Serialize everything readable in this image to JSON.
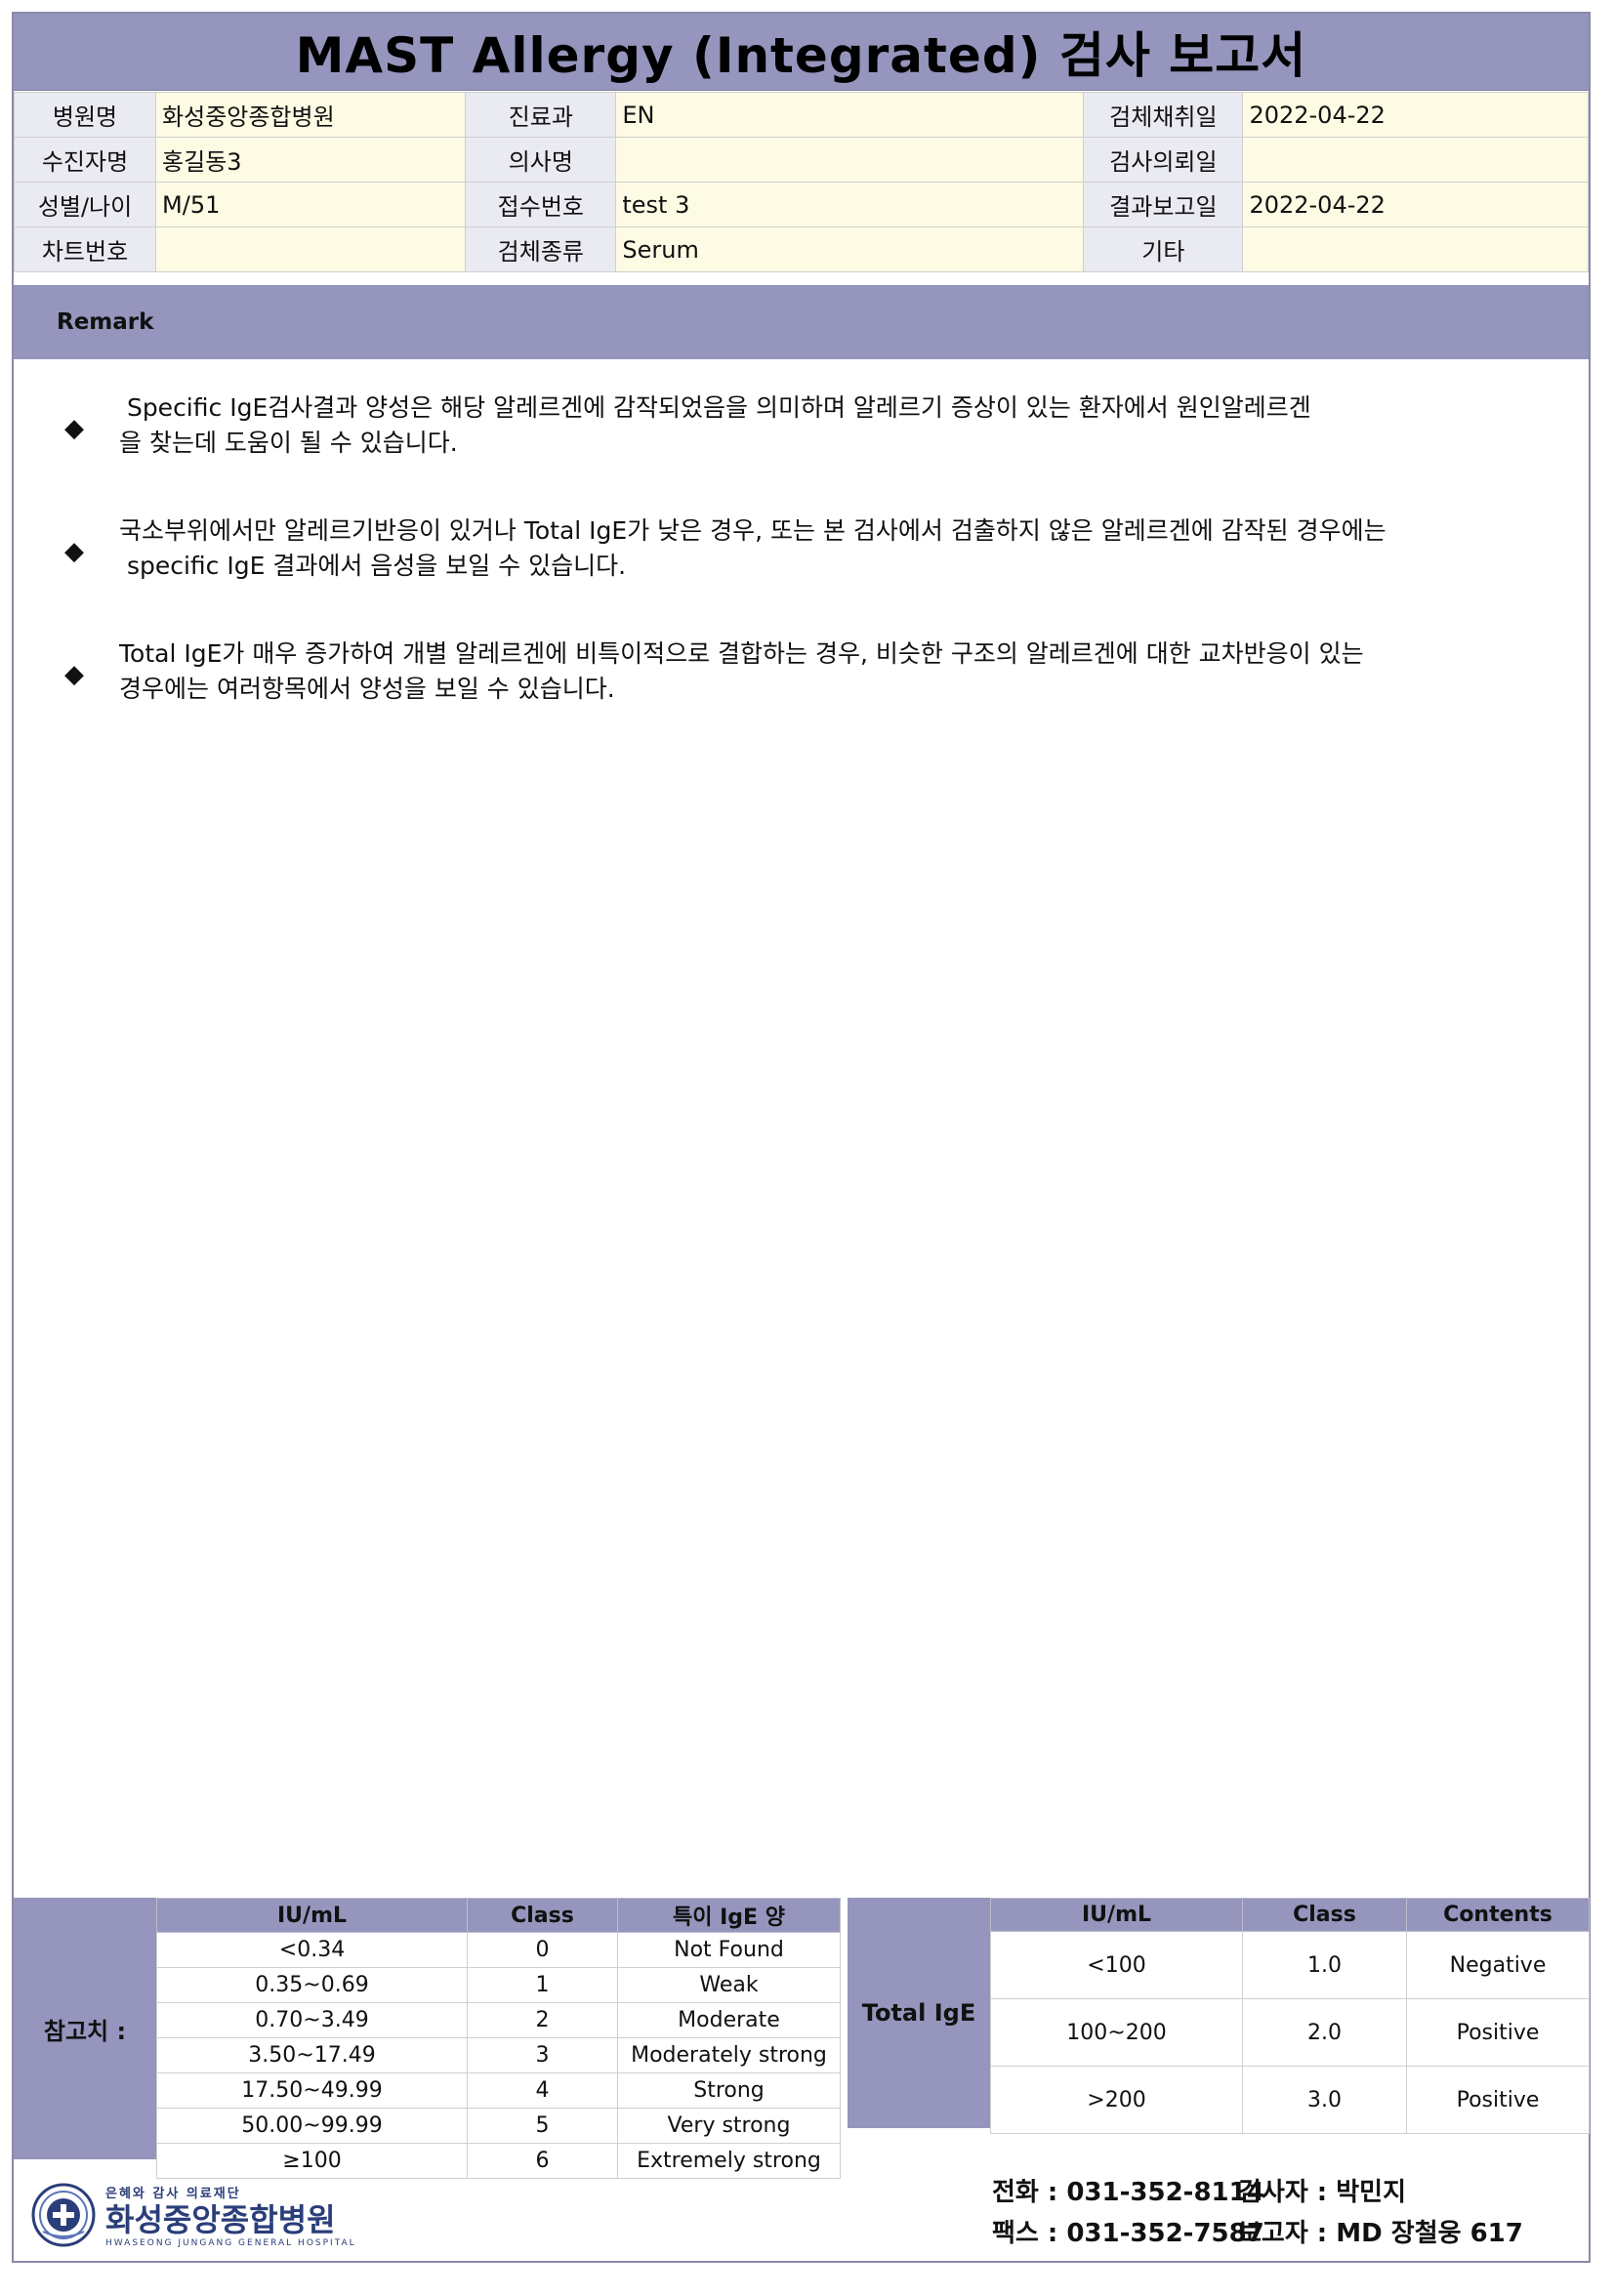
{
  "title": "MAST Allergy (Integrated) 검사 보고서",
  "info": {
    "rows": [
      [
        {
          "label": "병원명",
          "value": "화성중앙종합병원"
        },
        {
          "label": "진료과",
          "value": "EN"
        },
        {
          "label": "검체채취일",
          "value": "2022-04-22"
        }
      ],
      [
        {
          "label": "수진자명",
          "value": "홍길동3"
        },
        {
          "label": "의사명",
          "value": ""
        },
        {
          "label": "검사의뢰일",
          "value": ""
        }
      ],
      [
        {
          "label": "성별/나이",
          "value": "M/51"
        },
        {
          "label": "접수번호",
          "value": "test 3"
        },
        {
          "label": "결과보고일",
          "value": "2022-04-22"
        }
      ],
      [
        {
          "label": "차트번호",
          "value": ""
        },
        {
          "label": "검체종류",
          "value": "Serum"
        },
        {
          "label": "기타",
          "value": ""
        }
      ]
    ]
  },
  "remark": {
    "label": "Remark",
    "bullet": "◆",
    "items": [
      {
        "line1": " Specific IgE검사결과 양성은 해당 알레르겐에 감작되었음을 의미하며 알레르기 증상이 있는 환자에서 원인알레르겐",
        "line2": "을 찾는데 도움이 될 수 있습니다."
      },
      {
        "line1": "국소부위에서만 알레르기반응이 있거나 Total IgE가 낮은 경우, 또는 본 검사에서 검출하지 않은 알레르겐에 감작된 경우에는",
        "line2": " specific IgE 결과에서 음성을 보일 수 있습니다."
      },
      {
        "line1": "Total IgE가 매우 증가하여 개별 알레르겐에 비특이적으로 결합하는 경우, 비슷한 구조의 알레르겐에 대한 교차반응이 있는",
        "line2": "경우에는 여러항목에서 양성을 보일 수 있습니다."
      }
    ]
  },
  "reference": {
    "label": "참고치 :",
    "headers": [
      "IU/mL",
      "Class",
      "특이 IgE 양"
    ],
    "rows": [
      [
        "<0.34",
        "0",
        "Not Found"
      ],
      [
        "0.35~0.69",
        "1",
        "Weak"
      ],
      [
        "0.70~3.49",
        "2",
        "Moderate"
      ],
      [
        "3.50~17.49",
        "3",
        "Moderately strong"
      ],
      [
        "17.50~49.99",
        "4",
        "Strong"
      ],
      [
        "50.00~99.99",
        "5",
        "Very strong"
      ],
      [
        "≥100",
        "6",
        "Extremely strong"
      ]
    ]
  },
  "total_ige": {
    "label": "Total IgE",
    "headers": [
      "IU/mL",
      "Class",
      "Contents"
    ],
    "rows": [
      [
        "<100",
        "1.0",
        "Negative"
      ],
      [
        "100~200",
        "2.0",
        "Positive"
      ],
      [
        ">200",
        "3.0",
        "Positive"
      ]
    ]
  },
  "logo": {
    "icon": "hospital-emblem-icon",
    "top_text": "은혜와 감사 의료재단",
    "name": "화성중앙종합병원",
    "english": "HWASEONG JUNGANG GENERAL HOSPITAL"
  },
  "contact": {
    "phone": "전화 : 031-352-8114",
    "fax": "팩스 : 031-352-7587",
    "examiner": "검사자 : 박민지",
    "reporter": "보고자 : MD 장철웅 617"
  },
  "colors": {
    "header_bar": "#9595bd",
    "label_cell": "#eaeaf2",
    "value_cell": "#fdfbe3",
    "logo_navy": "#2a3e7a"
  }
}
